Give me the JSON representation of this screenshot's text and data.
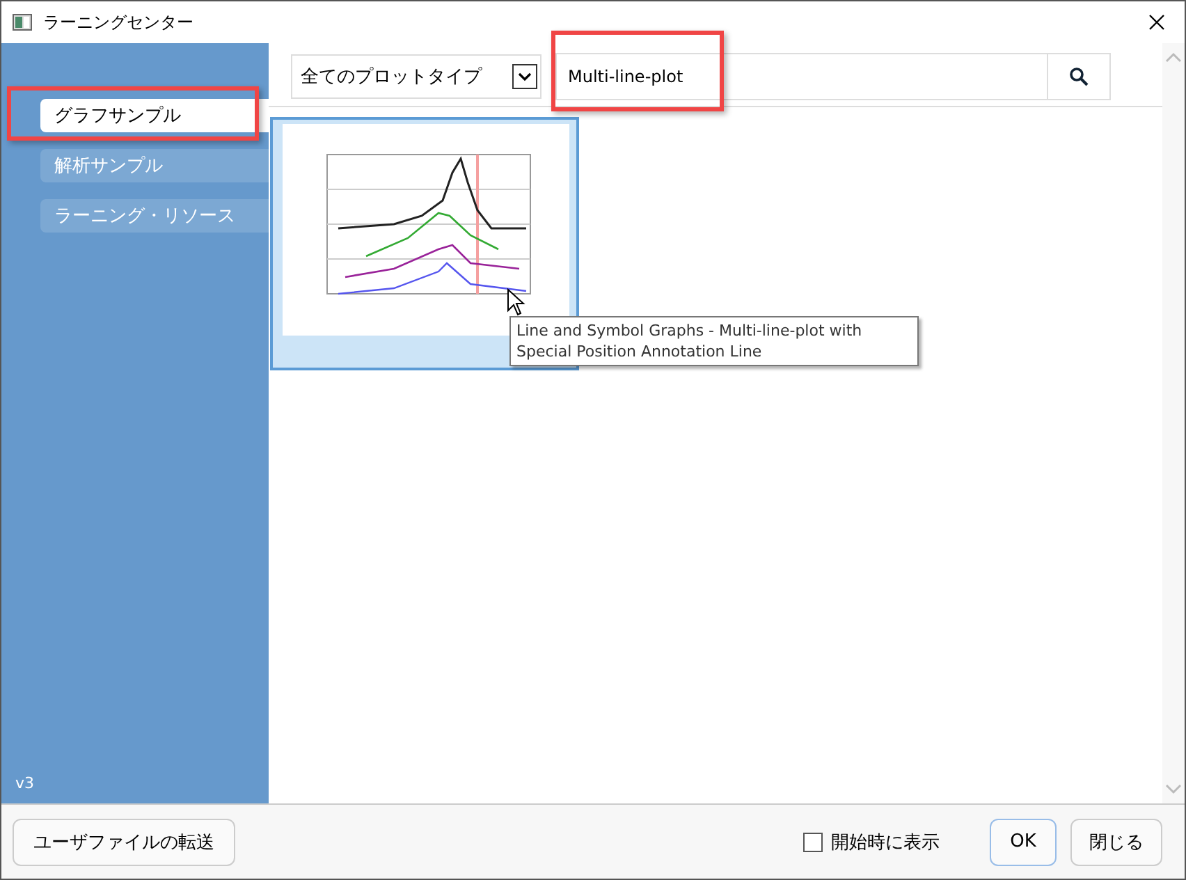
{
  "window": {
    "title": "ラーニングセンター"
  },
  "sidebar": {
    "items": [
      {
        "label": "グラフサンプル",
        "selected": true
      },
      {
        "label": "解析サンプル",
        "selected": false
      },
      {
        "label": "ラーニング・リソース",
        "selected": false
      }
    ],
    "version": "v3"
  },
  "filter": {
    "plot_type": "全てのプロットタイプ",
    "search": "Multi-line-plot"
  },
  "tooltip": "Line and Symbol Graphs - Multi-line-plot with Special Position Annotation Line",
  "footer": {
    "transfer_button": "ユーザファイルの転送",
    "show_on_startup": {
      "label": "開始時に表示",
      "checked": false
    },
    "buttons": [
      {
        "label": "OK",
        "kind": "default"
      },
      {
        "label": "閉じる",
        "kind": "normal"
      }
    ]
  }
}
